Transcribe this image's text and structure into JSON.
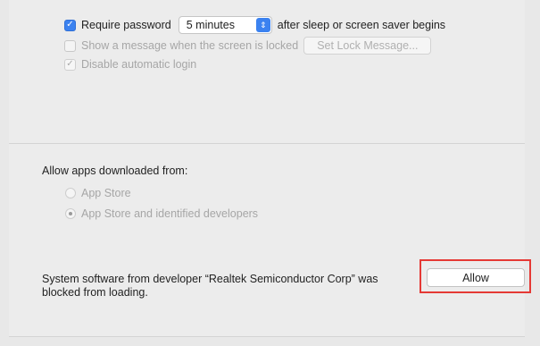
{
  "general": {
    "require_password": {
      "label": "Require password",
      "checked": true,
      "delay_value": "5 minutes",
      "suffix": "after sleep or screen saver begins"
    },
    "show_message": {
      "label": "Show a message when the screen is locked",
      "checked": false,
      "enabled": false,
      "button_label": "Set Lock Message..."
    },
    "disable_auto_login": {
      "label": "Disable automatic login",
      "checked": true,
      "enabled": false
    }
  },
  "allow_apps": {
    "heading": "Allow apps downloaded from:",
    "options": [
      {
        "label": "App Store",
        "selected": false,
        "enabled": false
      },
      {
        "label": "App Store and identified developers",
        "selected": true,
        "enabled": false
      }
    ]
  },
  "blocked_extension": {
    "message_line1": "System software from developer “Realtek Semiconductor Corp” was",
    "message_line2": "blocked from loading.",
    "allow_button": "Allow",
    "highlight_color": "#e53935"
  },
  "colors": {
    "accent": "#3b82f0",
    "background": "#ececec"
  }
}
